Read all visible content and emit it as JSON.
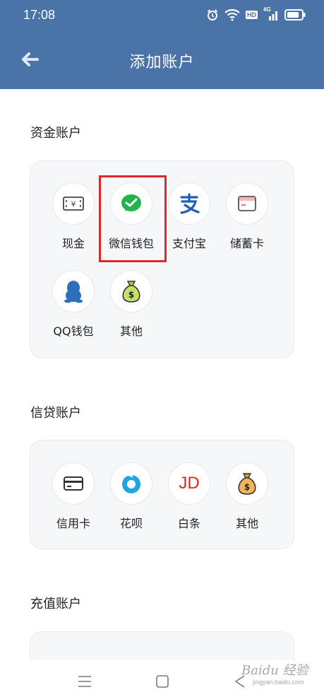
{
  "status_bar": {
    "time": "17:08",
    "hd": "HD",
    "network": "4G"
  },
  "header": {
    "title": "添加账户"
  },
  "sections": {
    "funds": {
      "title": "资金账户",
      "items": [
        {
          "label": "现金",
          "icon": "cash-icon"
        },
        {
          "label": "微信钱包",
          "icon": "wechat-pay-icon"
        },
        {
          "label": "支付宝",
          "icon": "alipay-icon"
        },
        {
          "label": "储蓄卡",
          "icon": "debit-card-icon"
        },
        {
          "label": "QQ钱包",
          "icon": "qq-icon"
        },
        {
          "label": "其他",
          "icon": "money-bag-icon"
        }
      ]
    },
    "credit": {
      "title": "信贷账户",
      "items": [
        {
          "label": "信用卡",
          "icon": "credit-card-icon"
        },
        {
          "label": "花呗",
          "icon": "huabei-icon"
        },
        {
          "label": "白条",
          "icon": "jd-icon",
          "icon_text": "JD"
        },
        {
          "label": "其他",
          "icon": "money-bag-icon"
        }
      ]
    },
    "recharge": {
      "title": "充值账户"
    }
  },
  "watermark": {
    "main": "Baidu 经验",
    "sub": "jingyan.baidu.com"
  },
  "colors": {
    "header": "#4a74a8",
    "highlight": "#e0262b",
    "wechat": "#22b34a",
    "alipay": "#1f5fb3",
    "jd": "#e1251b"
  }
}
